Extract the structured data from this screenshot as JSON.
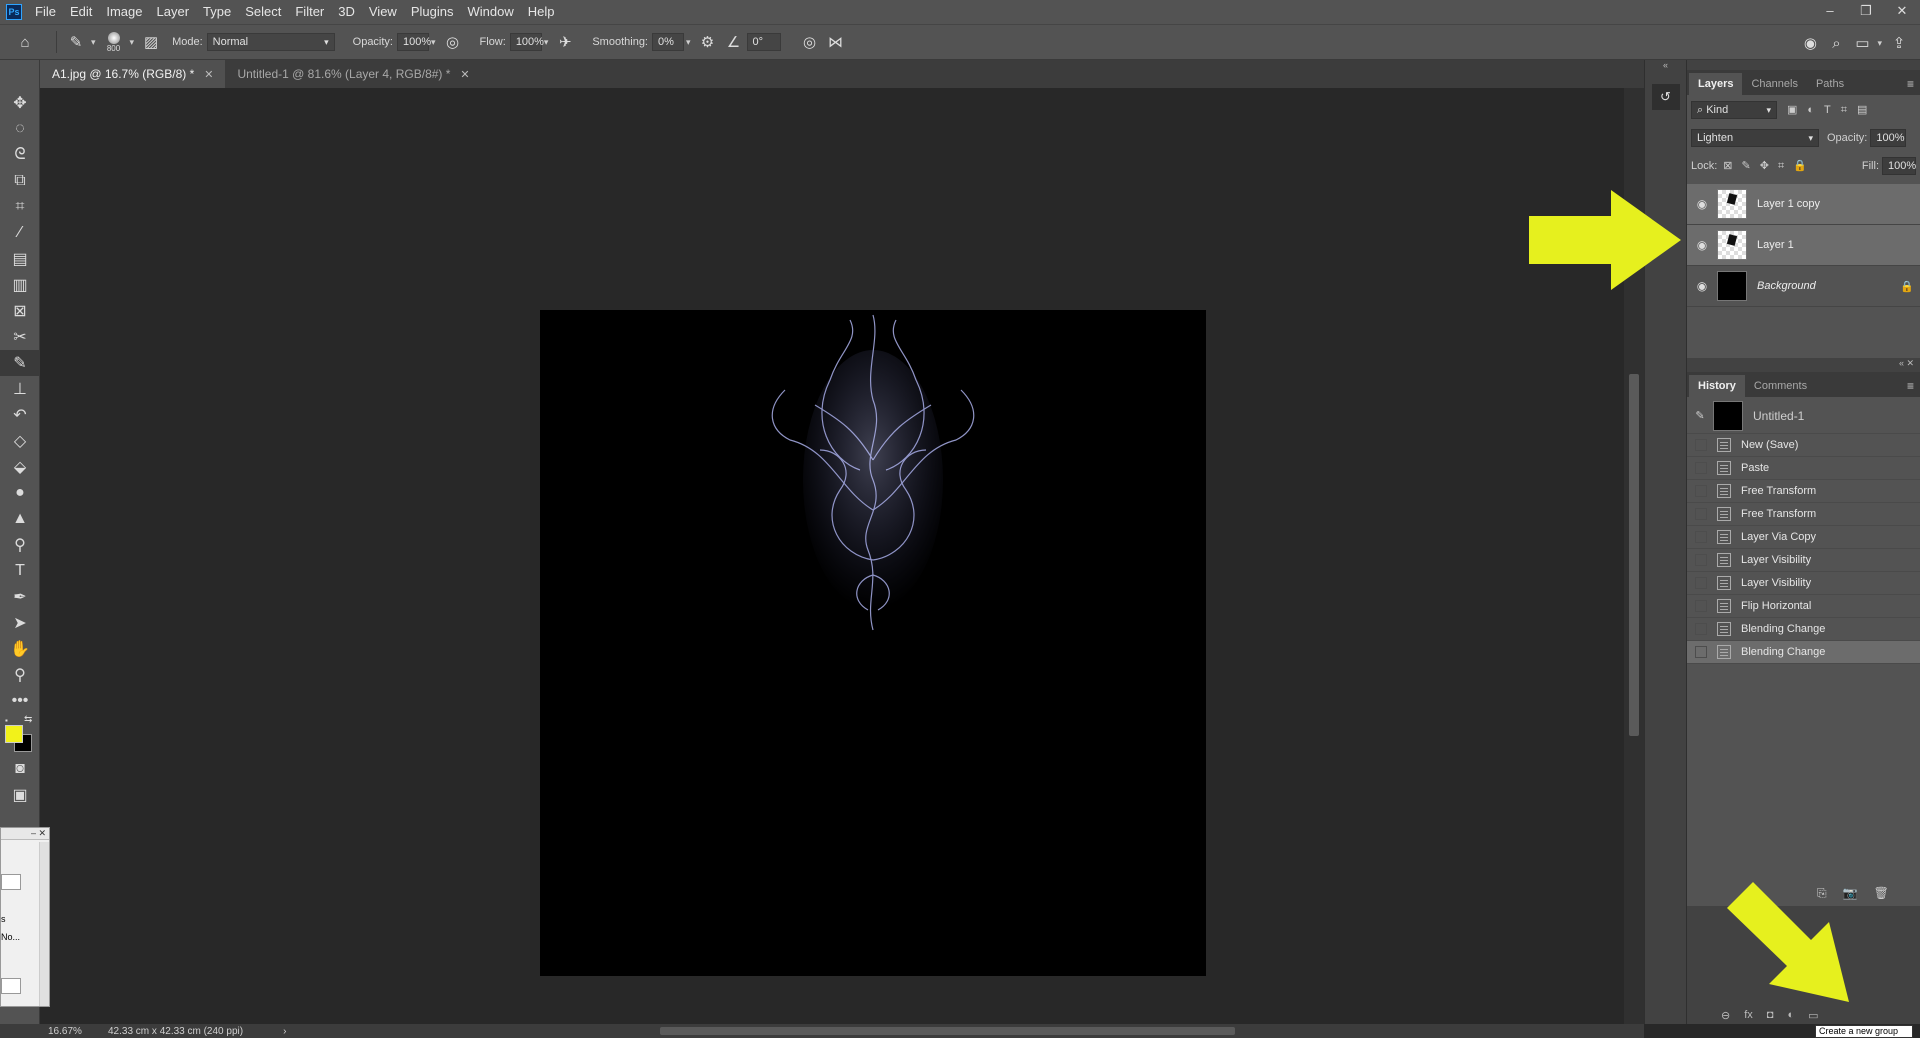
{
  "menubar": {
    "items": [
      "File",
      "Edit",
      "Image",
      "Layer",
      "Type",
      "Select",
      "Filter",
      "3D",
      "View",
      "Plugins",
      "Window",
      "Help"
    ]
  },
  "options": {
    "brush_size": "800",
    "mode_label": "Mode:",
    "mode_value": "Normal",
    "opacity_label": "Opacity:",
    "opacity_value": "100%",
    "flow_label": "Flow:",
    "flow_value": "100%",
    "smoothing_label": "Smoothing:",
    "smoothing_value": "0%",
    "angle_value": "0°"
  },
  "tabs": [
    {
      "label": "A1.jpg @ 16.7% (RGB/8) *"
    },
    {
      "label": "Untitled-1 @ 81.6% (Layer 4, RGB/8#) *"
    }
  ],
  "tools": [
    "move-tool",
    "marquee-tool",
    "lasso-tool",
    "object-select-tool",
    "crop-tool",
    "eyedropper-tool",
    "healing-brush-tool",
    "bandage-tool",
    "frame-tool",
    "scissors-tool",
    "brush-tool",
    "stamp-tool",
    "history-brush-tool",
    "eraser-tool",
    "paint-bucket-tool",
    "blur-tool",
    "sharpen-tool",
    "dodge-tool",
    "type-tool",
    "pen-tool",
    "path-select-tool",
    "hand-tool",
    "zoom-tool",
    "more-tools"
  ],
  "colors": {
    "foreground": "#f2f21a",
    "background": "#000000",
    "arrow": "#e6f01e"
  },
  "layers_panel": {
    "tabs": [
      "Layers",
      "Channels",
      "Paths"
    ],
    "kind_label": "Kind",
    "blend_mode": "Lighten",
    "opacity_label": "Opacity:",
    "opacity_value": "100%",
    "lock_label": "Lock:",
    "fill_label": "Fill:",
    "fill_value": "100%",
    "layers": [
      {
        "name": "Layer 1 copy"
      },
      {
        "name": "Layer 1"
      },
      {
        "name": "Background"
      }
    ]
  },
  "history_panel": {
    "tabs": [
      "History",
      "Comments"
    ],
    "snapshot": "Untitled-1",
    "items": [
      "New (Save)",
      "Paste",
      "Free Transform",
      "Free Transform",
      "Layer Via Copy",
      "Layer Visibility",
      "Layer Visibility",
      "Flip Horizontal",
      "Blending Change",
      "Blending Change"
    ]
  },
  "status": {
    "zoom": "16.67%",
    "doc_info": "42.33 cm x 42.33 cm (240 ppi)"
  },
  "tooltip": "Create a new group",
  "dialog": {
    "line1": "s",
    "line2": "No..."
  }
}
